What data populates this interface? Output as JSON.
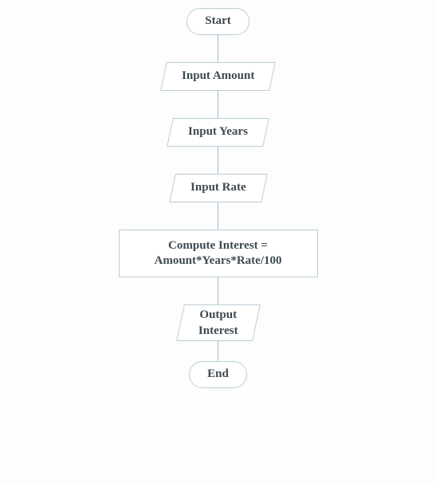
{
  "flowchart": {
    "start": "Start",
    "input_amount": "Input Amount",
    "input_years": "Input Years",
    "input_rate": "Input Rate",
    "compute_line1": "Compute Interest =",
    "compute_line2": "Amount*Years*Rate/100",
    "output_line1": "Output",
    "output_line2": "Interest",
    "end": "End"
  }
}
